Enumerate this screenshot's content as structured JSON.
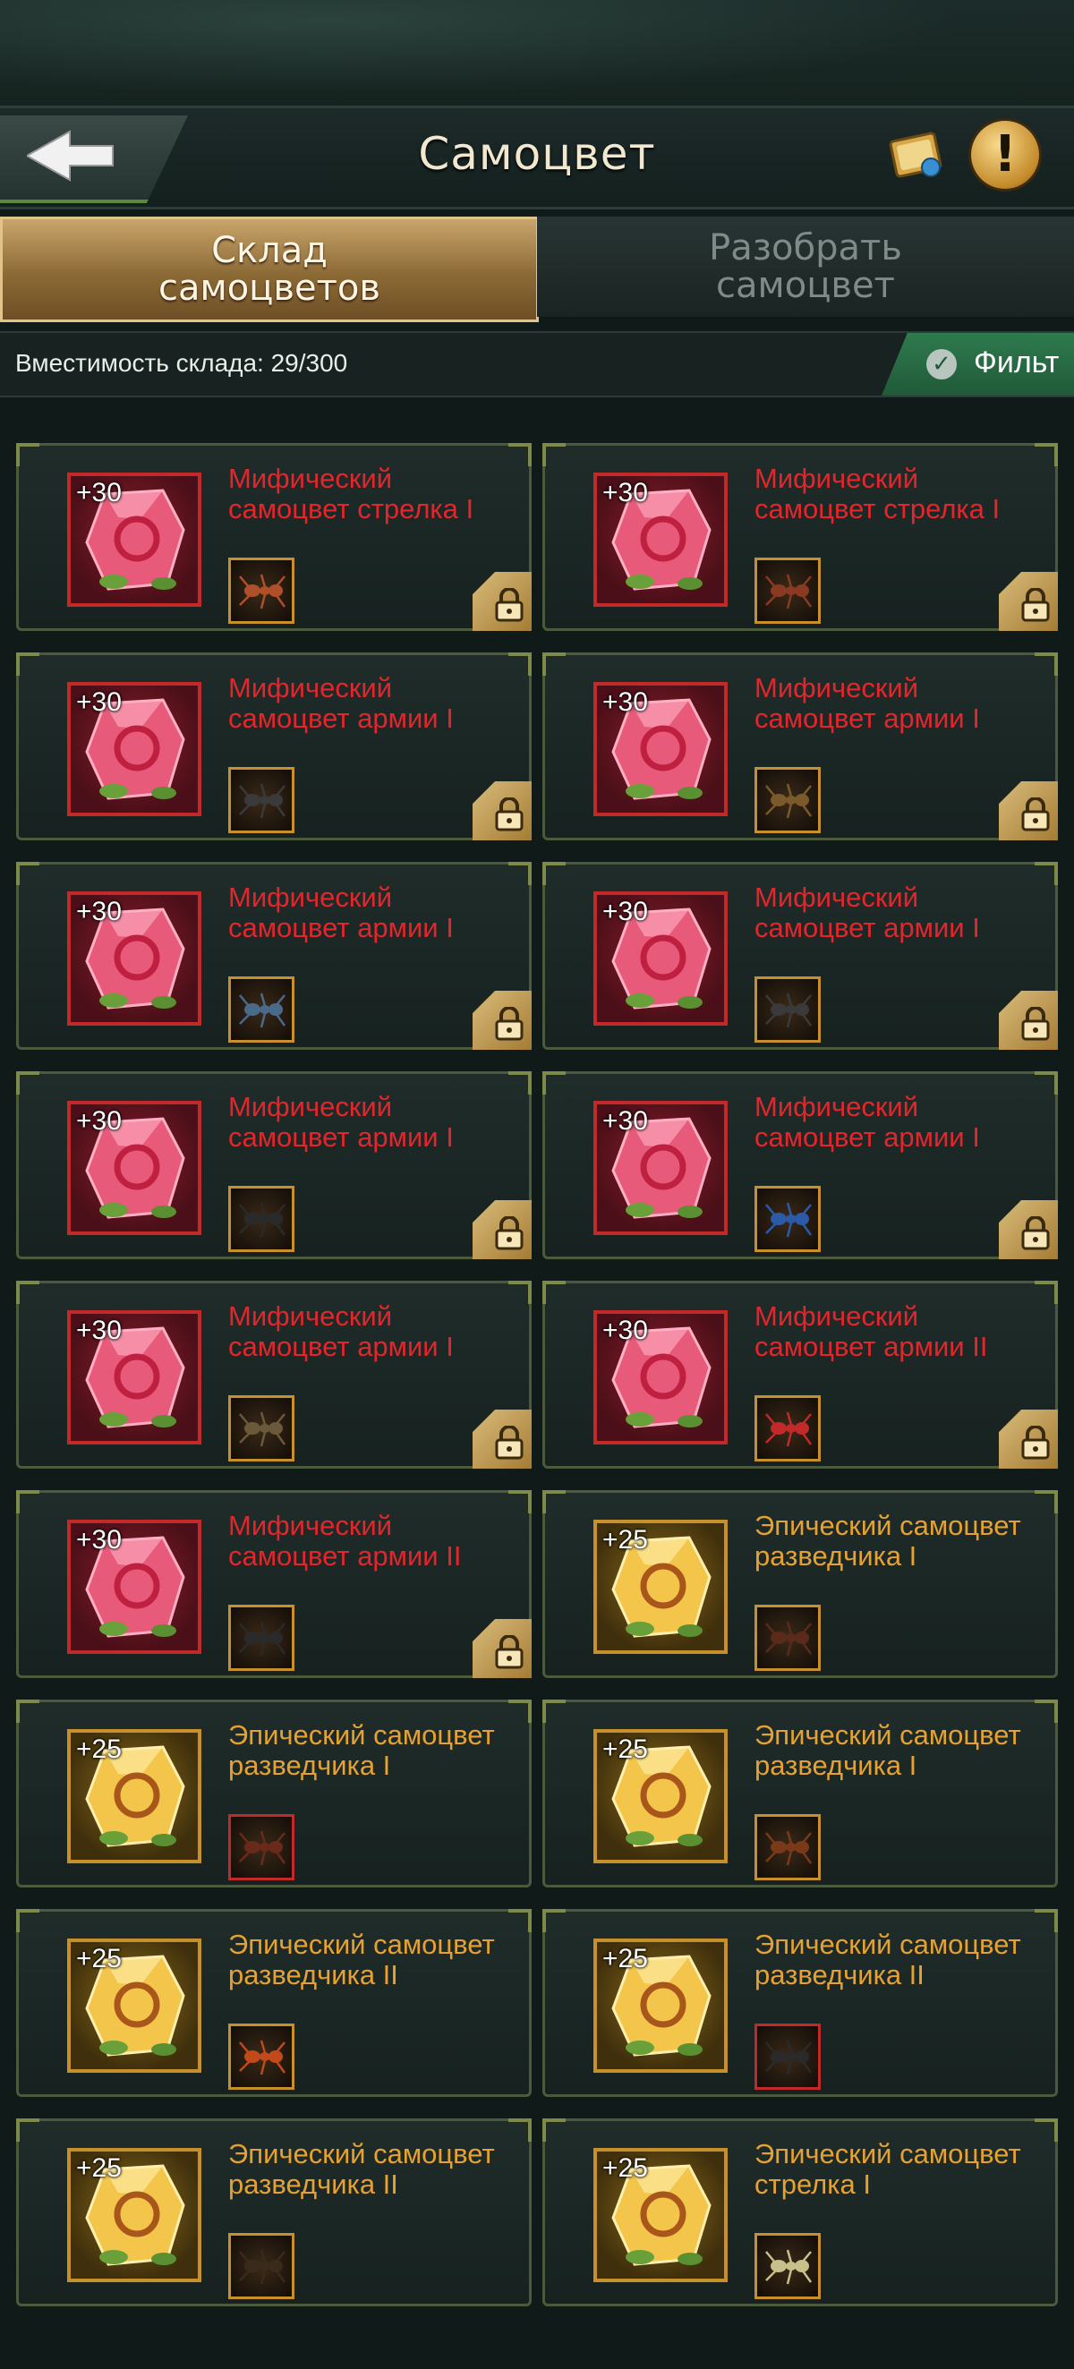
{
  "header": {
    "title": "Самоцвет",
    "back_label": "back",
    "book_icon": "gem-book-icon",
    "info_icon": "info-icon",
    "info_symbol": "!"
  },
  "tabs": [
    {
      "label_line1": "Склад",
      "label_line2": "самоцветов",
      "active": true
    },
    {
      "label_line1": "Разобрать",
      "label_line2": "самоцвет",
      "active": false
    }
  ],
  "capacity": {
    "text": "Вместимость склада: 29/300"
  },
  "filter": {
    "label": "Фильт"
  },
  "colors": {
    "mythic": "#e3262b",
    "epic": "#e5a232",
    "filter_bg": "#2f7a4f"
  },
  "gems": [
    {
      "level": "+30",
      "name": "Мифический самоцвет стрелка I",
      "rarity": "mythic",
      "locked": true,
      "unit_color": "#b0502a"
    },
    {
      "level": "+30",
      "name": "Мифический самоцвет стрелка I",
      "rarity": "mythic",
      "locked": true,
      "unit_color": "#8a3a22"
    },
    {
      "level": "+30",
      "name": "Мифический самоцвет армии I",
      "rarity": "mythic",
      "locked": true,
      "unit_color": "#3a3a3a"
    },
    {
      "level": "+30",
      "name": "Мифический самоцвет армии I",
      "rarity": "mythic",
      "locked": true,
      "unit_color": "#7a5a2a"
    },
    {
      "level": "+30",
      "name": "Мифический самоцвет армии I",
      "rarity": "mythic",
      "locked": true,
      "unit_color": "#4a6a8a"
    },
    {
      "level": "+30",
      "name": "Мифический самоцвет армии I",
      "rarity": "mythic",
      "locked": true,
      "unit_color": "#3a3a3a"
    },
    {
      "level": "+30",
      "name": "Мифический самоцвет армии I",
      "rarity": "mythic",
      "locked": true,
      "unit_color": "#2a2a2a"
    },
    {
      "level": "+30",
      "name": "Мифический самоцвет армии I",
      "rarity": "mythic",
      "locked": true,
      "unit_color": "#2a5aa8"
    },
    {
      "level": "+30",
      "name": "Мифический самоцвет армии I",
      "rarity": "mythic",
      "locked": true,
      "unit_color": "#6a5a3a"
    },
    {
      "level": "+30",
      "name": "Мифический самоцвет армии II",
      "rarity": "mythic",
      "locked": true,
      "unit_color": "#c22a2a"
    },
    {
      "level": "+30",
      "name": "Мифический самоцвет армии II",
      "rarity": "mythic",
      "locked": true,
      "unit_color": "#2a2a2a"
    },
    {
      "level": "+25",
      "name": "Эпический самоцвет разведчика I",
      "rarity": "epic",
      "locked": false,
      "unit_color": "#5a2a1a"
    },
    {
      "level": "+25",
      "name": "Эпический самоцвет разведчика I",
      "rarity": "epic",
      "locked": false,
      "unit_color": "#6a2a1a"
    },
    {
      "level": "+25",
      "name": "Эпический самоцвет разведчика I",
      "rarity": "epic",
      "locked": false,
      "unit_color": "#7a3a1a"
    },
    {
      "level": "+25",
      "name": "Эпический самоцвет разведчика II",
      "rarity": "epic",
      "locked": false,
      "unit_color": "#c24a1a"
    },
    {
      "level": "+25",
      "name": "Эпический самоцвет разведчика II",
      "rarity": "epic",
      "locked": false,
      "unit_color": "#2a2a2a"
    },
    {
      "level": "+25",
      "name": "Эпический самоцвет разведчика II",
      "rarity": "epic",
      "locked": false,
      "unit_color": "#3a2a1a"
    },
    {
      "level": "+25",
      "name": "Эпический самоцвет стрелка I",
      "rarity": "epic",
      "locked": false,
      "unit_color": "#c8c08a"
    }
  ]
}
